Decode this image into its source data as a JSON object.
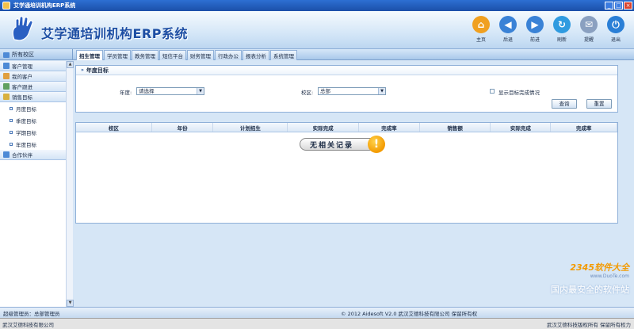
{
  "window": {
    "title": "艾学通培训机构ERP系统"
  },
  "brand": {
    "name": "艾学通培训机构ERP系统"
  },
  "toolbar": [
    {
      "label": "主页",
      "icon": "home-icon",
      "color": "#f0a020",
      "glyph": "⌂"
    },
    {
      "label": "后退",
      "icon": "back-icon",
      "color": "#3a82d6",
      "glyph": "◀"
    },
    {
      "label": "前进",
      "icon": "forward-icon",
      "color": "#3a82d6",
      "glyph": "▶"
    },
    {
      "label": "刷新",
      "icon": "refresh-icon",
      "color": "#2f9be0",
      "glyph": "↻"
    },
    {
      "label": "提醒",
      "icon": "reminder-icon",
      "color": "#8aa0c0",
      "glyph": "✉"
    },
    {
      "label": "退出",
      "icon": "power-icon",
      "color": "#2a7fd6",
      "glyph": "⏻"
    }
  ],
  "campus_tab": "所有校区",
  "tabs": [
    "招生管理",
    "学员管理",
    "教务管理",
    "短信平台",
    "财务管理",
    "行政办公",
    "报表分析",
    "系统管理"
  ],
  "sidebar": {
    "items": [
      {
        "label": "客户管理",
        "color": "#4d8ad6"
      },
      {
        "label": "我的客户",
        "color": "#e0a040"
      },
      {
        "label": "客户跟进",
        "color": "#60a060"
      },
      {
        "label": "销售目标",
        "color": "#d8b040"
      }
    ],
    "subitems": [
      "月度目标",
      "季度目标",
      "学期目标",
      "年度目标"
    ],
    "footer_item": {
      "label": "合作伙伴",
      "color": "#4d8ad6"
    }
  },
  "panel": {
    "title": "年度目标",
    "year_label": "年度:",
    "year_value": "请选择",
    "campus_label": "校区:",
    "campus_value": "总部",
    "show_complete_label": "显示目标完成情况",
    "query_button": "查询",
    "reset_button": "重置"
  },
  "grid": {
    "columns": [
      "校区",
      "年份",
      "计划招生",
      "实际完成",
      "完成率",
      "销售额",
      "实际完成",
      "完成率"
    ],
    "empty_text": "无相关记录"
  },
  "status": {
    "user": "超级管理员：总部管理员",
    "copyright": "© 2012 Aidesoft V2.0 武汉艾德科技有限公司 保留所有权"
  },
  "bottom": {
    "left": "武汉艾德科技有限公司",
    "right": "武汉艾德科技版权所有 保留所有权力"
  },
  "watermarks": {
    "center": "www.DuoTe.com",
    "corner_brand": "2345软件大全",
    "corner_url": "www.DuoTe.com",
    "corner_slogan": "国内最安全的软件站"
  }
}
